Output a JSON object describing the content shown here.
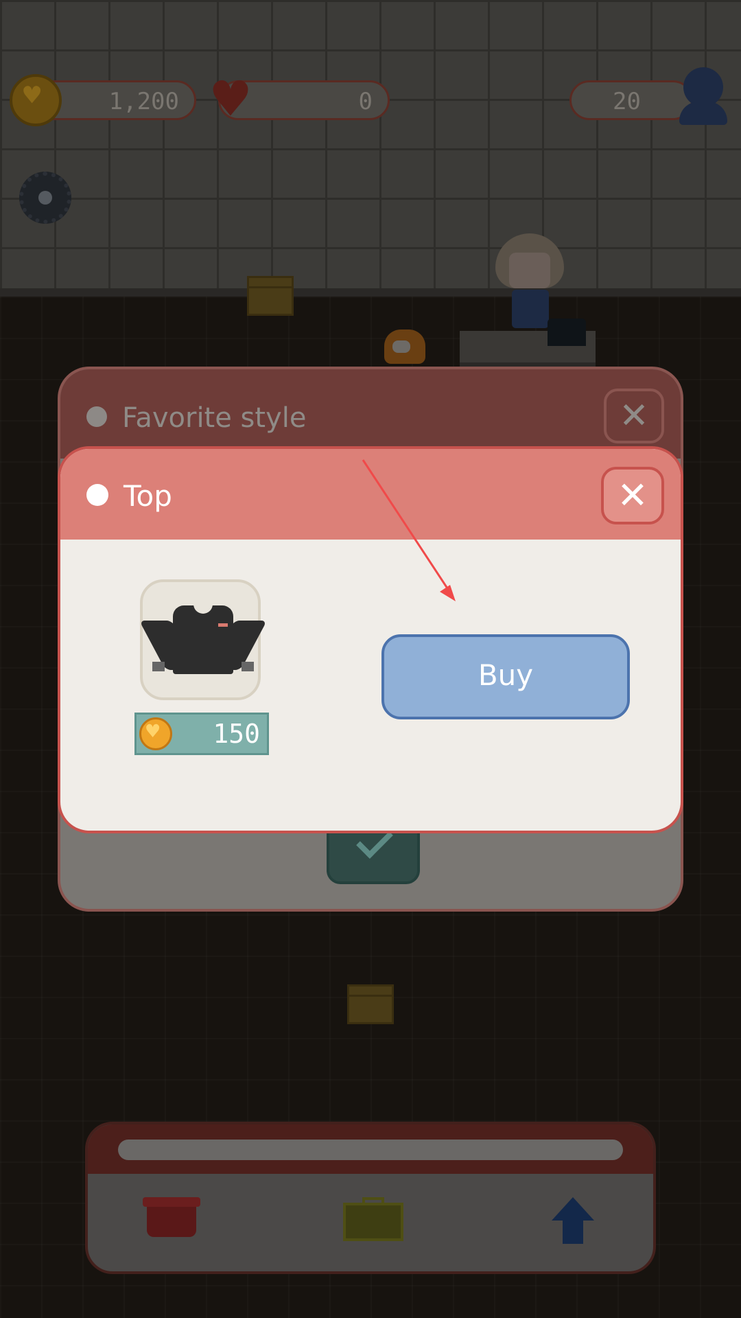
{
  "hud": {
    "coins": "1,200",
    "hearts": "0",
    "customers": "20"
  },
  "back_dialog": {
    "title": "Favorite style",
    "close_symbol": "✕"
  },
  "front_dialog": {
    "title": "Top",
    "close_symbol": "✕",
    "item": {
      "icon": "black-sweater-icon",
      "price": "150"
    },
    "buy_label": "Buy"
  },
  "colors": {
    "header_red": "#dc8078",
    "buy_blue": "#90b0d7",
    "price_teal": "#7fb0aa",
    "annotation_arrow": "#f04a4a"
  }
}
